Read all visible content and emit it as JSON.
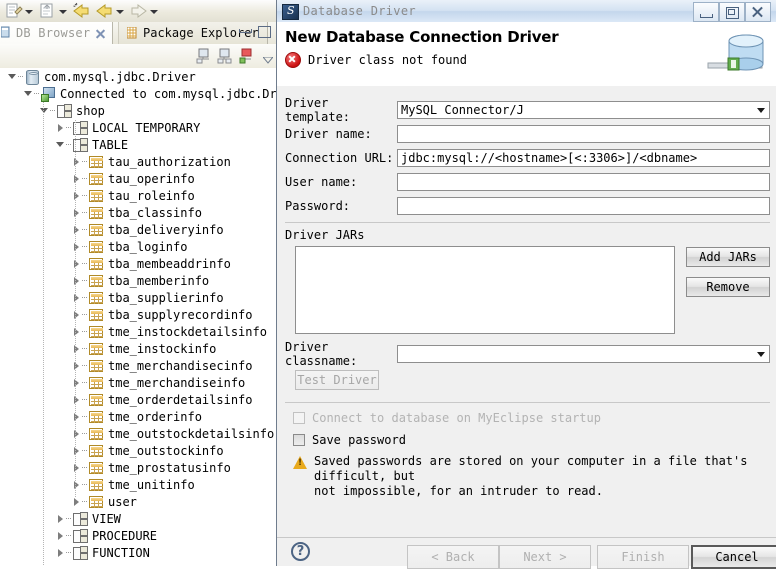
{
  "ide": {
    "toolbar": {
      "buttons": [
        {
          "name": "new-wizard-icon",
          "caret": true
        },
        {
          "name": "export-icon",
          "caret": true
        },
        {
          "name": "back-arrow-icon",
          "caret": false
        },
        {
          "name": "back-history-icon",
          "caret": true
        },
        {
          "name": "forward-arrow-icon",
          "caret": true
        }
      ]
    },
    "tabs": [
      {
        "label": "DB Browser",
        "active": true,
        "closable": true
      },
      {
        "label": "Package Explorer",
        "active": false,
        "closable": false
      }
    ],
    "view_toolbar": {
      "icons": [
        "new-connection-icon",
        "edit-connection-icon",
        "open-connection-icon",
        "view-menu-icon"
      ]
    },
    "tree": [
      {
        "label": "com.mysql.jdbc.Driver",
        "depth": 0,
        "icon": "driver-icon",
        "state": "open"
      },
      {
        "label": "Connected to com.mysql.jdbc.Driver",
        "depth": 1,
        "icon": "connection-icon",
        "state": "open"
      },
      {
        "label": "shop",
        "depth": 2,
        "icon": "schema-icon",
        "state": "open"
      },
      {
        "label": "LOCAL TEMPORARY",
        "depth": 3,
        "icon": "schema-icon",
        "state": "closed"
      },
      {
        "label": "TABLE",
        "depth": 3,
        "icon": "schema-icon",
        "state": "open"
      },
      {
        "label": "tau_authorization",
        "depth": 4,
        "icon": "table-icon",
        "state": "closed"
      },
      {
        "label": "tau_operinfo",
        "depth": 4,
        "icon": "table-icon",
        "state": "closed"
      },
      {
        "label": "tau_roleinfo",
        "depth": 4,
        "icon": "table-icon",
        "state": "closed"
      },
      {
        "label": "tba_classinfo",
        "depth": 4,
        "icon": "table-icon",
        "state": "closed"
      },
      {
        "label": "tba_deliveryinfo",
        "depth": 4,
        "icon": "table-icon",
        "state": "closed"
      },
      {
        "label": "tba_loginfo",
        "depth": 4,
        "icon": "table-icon",
        "state": "closed"
      },
      {
        "label": "tba_membeaddrinfo",
        "depth": 4,
        "icon": "table-icon",
        "state": "closed"
      },
      {
        "label": "tba_memberinfo",
        "depth": 4,
        "icon": "table-icon",
        "state": "closed"
      },
      {
        "label": "tba_supplierinfo",
        "depth": 4,
        "icon": "table-icon",
        "state": "closed"
      },
      {
        "label": "tba_supplyrecordinfo",
        "depth": 4,
        "icon": "table-icon",
        "state": "closed"
      },
      {
        "label": "tme_instockdetailsinfo",
        "depth": 4,
        "icon": "table-icon",
        "state": "closed"
      },
      {
        "label": "tme_instockinfo",
        "depth": 4,
        "icon": "table-icon",
        "state": "closed"
      },
      {
        "label": "tme_merchandisecinfo",
        "depth": 4,
        "icon": "table-icon",
        "state": "closed"
      },
      {
        "label": "tme_merchandiseinfo",
        "depth": 4,
        "icon": "table-icon",
        "state": "closed"
      },
      {
        "label": "tme_orderdetailsinfo",
        "depth": 4,
        "icon": "table-icon",
        "state": "closed"
      },
      {
        "label": "tme_orderinfo",
        "depth": 4,
        "icon": "table-icon",
        "state": "closed"
      },
      {
        "label": "tme_outstockdetailsinfo",
        "depth": 4,
        "icon": "table-icon",
        "state": "closed"
      },
      {
        "label": "tme_outstockinfo",
        "depth": 4,
        "icon": "table-icon",
        "state": "closed"
      },
      {
        "label": "tme_prostatusinfo",
        "depth": 4,
        "icon": "table-icon",
        "state": "closed"
      },
      {
        "label": "tme_unitinfo",
        "depth": 4,
        "icon": "table-icon",
        "state": "closed"
      },
      {
        "label": "user",
        "depth": 4,
        "icon": "table-icon",
        "state": "closed"
      },
      {
        "label": "VIEW",
        "depth": 3,
        "icon": "schema-icon",
        "state": "closed"
      },
      {
        "label": "PROCEDURE",
        "depth": 3,
        "icon": "schema-icon",
        "state": "closed"
      },
      {
        "label": "FUNCTION",
        "depth": 3,
        "icon": "schema-icon",
        "state": "closed"
      }
    ]
  },
  "dialog": {
    "window_title": "Database Driver",
    "heading": "New Database Connection Driver",
    "error_message": "Driver class not found",
    "window_buttons": [
      "minimize",
      "maximize",
      "close"
    ],
    "fields": [
      {
        "label": "Driver template:",
        "value": "MySQL Connector/J",
        "type": "combo"
      },
      {
        "label": "Driver name:",
        "value": "",
        "type": "text"
      },
      {
        "label": "Connection URL:",
        "value": "jdbc:mysql://<hostname>[<:3306>]/<dbname>",
        "type": "text"
      },
      {
        "label": "User name:",
        "value": "",
        "type": "text"
      },
      {
        "label": "Password:",
        "value": "",
        "type": "password"
      }
    ],
    "jars_group_label": "Driver JARs",
    "jars_list": [],
    "add_jars_label": "Add JARs",
    "remove_label": "Remove",
    "classname_label": "Driver classname:",
    "classname_value": "",
    "test_driver_label": "Test Driver",
    "test_driver_enabled": false,
    "checkboxes": [
      {
        "label": "Connect to database on MyEclipse startup",
        "checked": false,
        "enabled": false
      },
      {
        "label": "Save password",
        "checked": false,
        "enabled": true
      }
    ],
    "warning_line1": "Saved passwords are stored on your computer in a file that's difficult, but",
    "warning_line2": "not impossible, for an intruder to read.",
    "help_label": "?",
    "footer_buttons": [
      {
        "label": "< Back",
        "enabled": false
      },
      {
        "label": "Next >",
        "enabled": false
      },
      {
        "label": "Finish",
        "enabled": false
      },
      {
        "label": "Cancel",
        "enabled": true,
        "default": true
      }
    ]
  }
}
